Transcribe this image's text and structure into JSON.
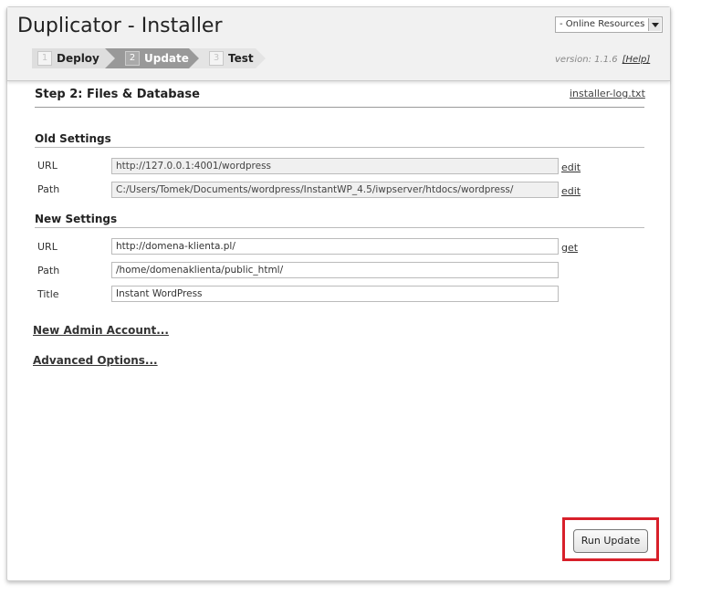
{
  "header": {
    "title": "Duplicator - Installer",
    "resources_select": "- Online Resources -",
    "version": "version: 1.1.6",
    "help_link": "[Help]"
  },
  "steps": [
    {
      "number": "1",
      "label": "Deploy",
      "state": "done"
    },
    {
      "number": "2",
      "label": "Update",
      "state": "active"
    },
    {
      "number": "3",
      "label": "Test",
      "state": "pending"
    }
  ],
  "main": {
    "section_title": "Step 2: Files & Database",
    "log_link": "installer-log.txt",
    "old_settings": {
      "title": "Old Settings",
      "rows": [
        {
          "label": "URL",
          "value": "http://127.0.0.1:4001/wordpress",
          "action": "edit"
        },
        {
          "label": "Path",
          "value": "C:/Users/Tomek/Documents/wordpress/InstantWP_4.5/iwpserver/htdocs/wordpress/",
          "action": "edit"
        }
      ]
    },
    "new_settings": {
      "title": "New Settings",
      "rows": [
        {
          "label": "URL",
          "value": "http://domena-klienta.pl/",
          "action": "get"
        },
        {
          "label": "Path",
          "value": "/home/domenaklienta/public_html/",
          "action": ""
        },
        {
          "label": "Title",
          "value": "Instant WordPress",
          "action": ""
        }
      ]
    },
    "new_admin_link": "New Admin Account...",
    "advanced_link": "Advanced Options...",
    "run_button": "Run Update"
  },
  "colors": {
    "highlight": "#d8202a",
    "active_step": "#999999"
  }
}
